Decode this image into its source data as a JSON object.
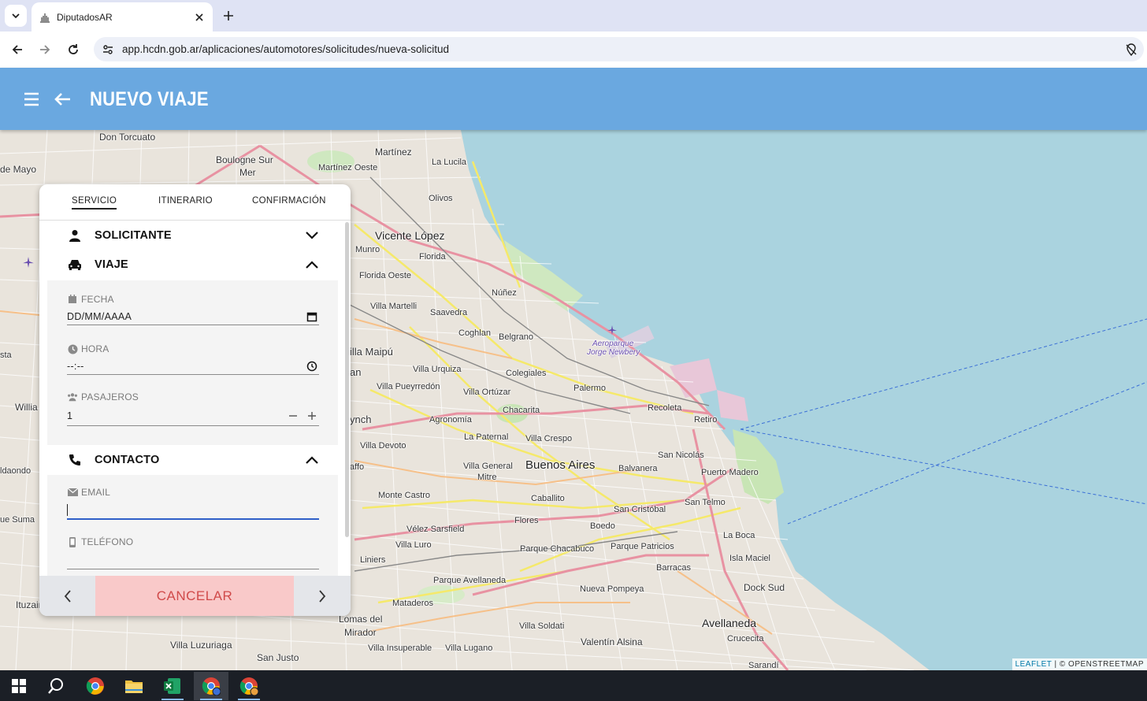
{
  "browser": {
    "tab_title": "DiputadosAR",
    "url": "app.hcdn.gob.ar/aplicaciones/automotores/solicitudes/nueva-solicitud"
  },
  "header": {
    "title": "NUEVO VIAJE"
  },
  "stepper": {
    "tabs": [
      "SERVICIO",
      "ITINERARIO",
      "CONFIRMACIÓN"
    ],
    "active": "SERVICIO"
  },
  "form": {
    "solicitante": {
      "label": "SOLICITANTE",
      "expanded": false
    },
    "viaje": {
      "label": "VIAJE",
      "expanded": true,
      "fecha": {
        "label": "FECHA",
        "placeholder": "DD/MM/AAAA"
      },
      "hora": {
        "label": "HORA",
        "placeholder": "--:--"
      },
      "pasajeros": {
        "label": "PASAJEROS",
        "value": "1"
      }
    },
    "contacto": {
      "label": "CONTACTO",
      "expanded": true,
      "email": {
        "label": "EMAIL",
        "value": ""
      },
      "telefono": {
        "label": "TELÉFONO",
        "value": ""
      }
    }
  },
  "footer": {
    "cancel_label": "CANCELAR"
  },
  "map": {
    "attribution_leaflet": "LEAFLET",
    "attribution_osm": " | © OPENSTREETMAP",
    "labels": [
      "Don Torcuato",
      "Boulogne Sur",
      "Mer",
      "Martínez",
      "Martínez Oeste",
      "La Lucila",
      "de Mayo",
      "Olivos",
      "Vicente López",
      "Munro",
      "Florida",
      "Florida Oeste",
      "Núñez",
      "Villa Martelli",
      "Saavedra",
      "Coghlan",
      "Belgrano",
      "Aeroparque",
      "Jorge Newbery",
      "illa Maipú",
      "Villa Urquiza",
      "Colegiales",
      "Villa Pueyrredón",
      "Villa Ortúzar",
      "Palermo",
      "Recoleta",
      "Retiro",
      "Agronomía",
      "Chacarita",
      "La Paternal",
      "Villa Crespo",
      "Villa Devoto",
      "Villa General",
      "Mitre",
      "Buenos Aires",
      "Balvanera",
      "San Nicolás",
      "Puerto Madero",
      "Monte Castro",
      "Caballito",
      "San Telmo",
      "San Cristóbal",
      "Vélez Sarsfield",
      "Flores",
      "Boedo",
      "Villa Luro",
      "Parque Chacabuco",
      "Parque Patricios",
      "La Boca",
      "Liniers",
      "Barracas",
      "Isla Maciel",
      "Parque Avellaneda",
      "Nueva Pompeya",
      "Dock Sud",
      "Mataderos",
      "Lomas del",
      "Mirador",
      "Villa Soldati",
      "Avellaneda",
      "Villa Luzuriaga",
      "Villa Insuperable",
      "Villa Lugano",
      "Valentín Alsina",
      "Crucecita",
      "San Justo",
      "Ituzaingó",
      "Willia",
      "ldaondo",
      "ue Suma",
      "ynch",
      "affo",
      "an",
      "sta",
      "Sarandí"
    ]
  },
  "taskbar": {
    "items": [
      "windows-start",
      "search",
      "chrome",
      "file-explorer",
      "excel",
      "chrome-profile-1",
      "chrome-profile-2"
    ]
  }
}
